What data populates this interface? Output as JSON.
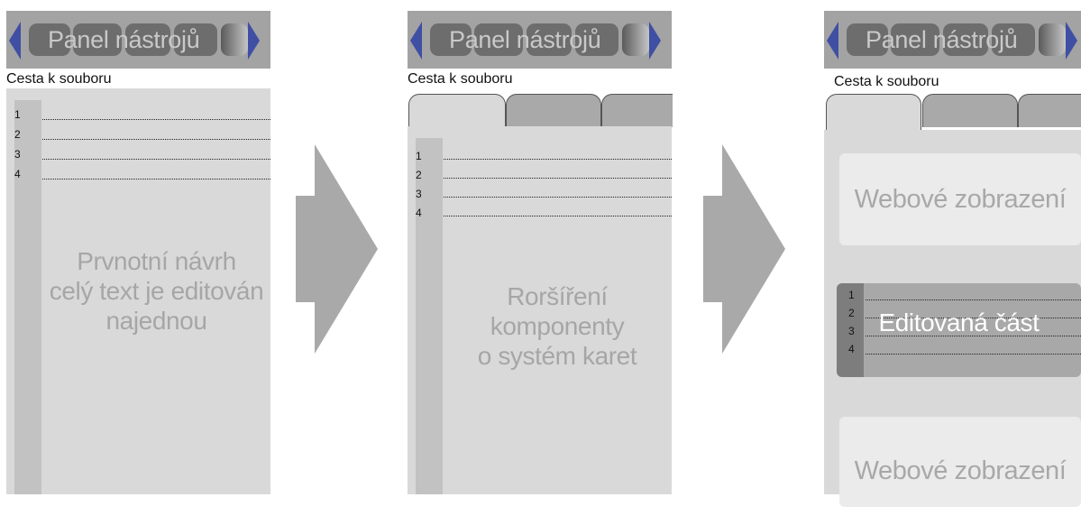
{
  "toolbar": {
    "title": "Panel nástrojů"
  },
  "path_label": "Cesta k souboru",
  "line_numbers": [
    "1",
    "2",
    "3",
    "4"
  ],
  "stage1": {
    "caption_lines": [
      "Prvnotní návrh",
      "celý text je editován",
      "najednou"
    ]
  },
  "stage2": {
    "caption_lines": [
      "Roršíření komponenty",
      "o systém karet"
    ]
  },
  "stage3": {
    "webview_label": "Webové zobrazení",
    "edited_label": "Editovaná část"
  },
  "colors": {
    "toolbar_bg": "#a3a3a3",
    "nav_arrow": "#3f4fa3",
    "editor_bg": "#d9d9d9",
    "flow_arrow": "#a9a9a9"
  }
}
